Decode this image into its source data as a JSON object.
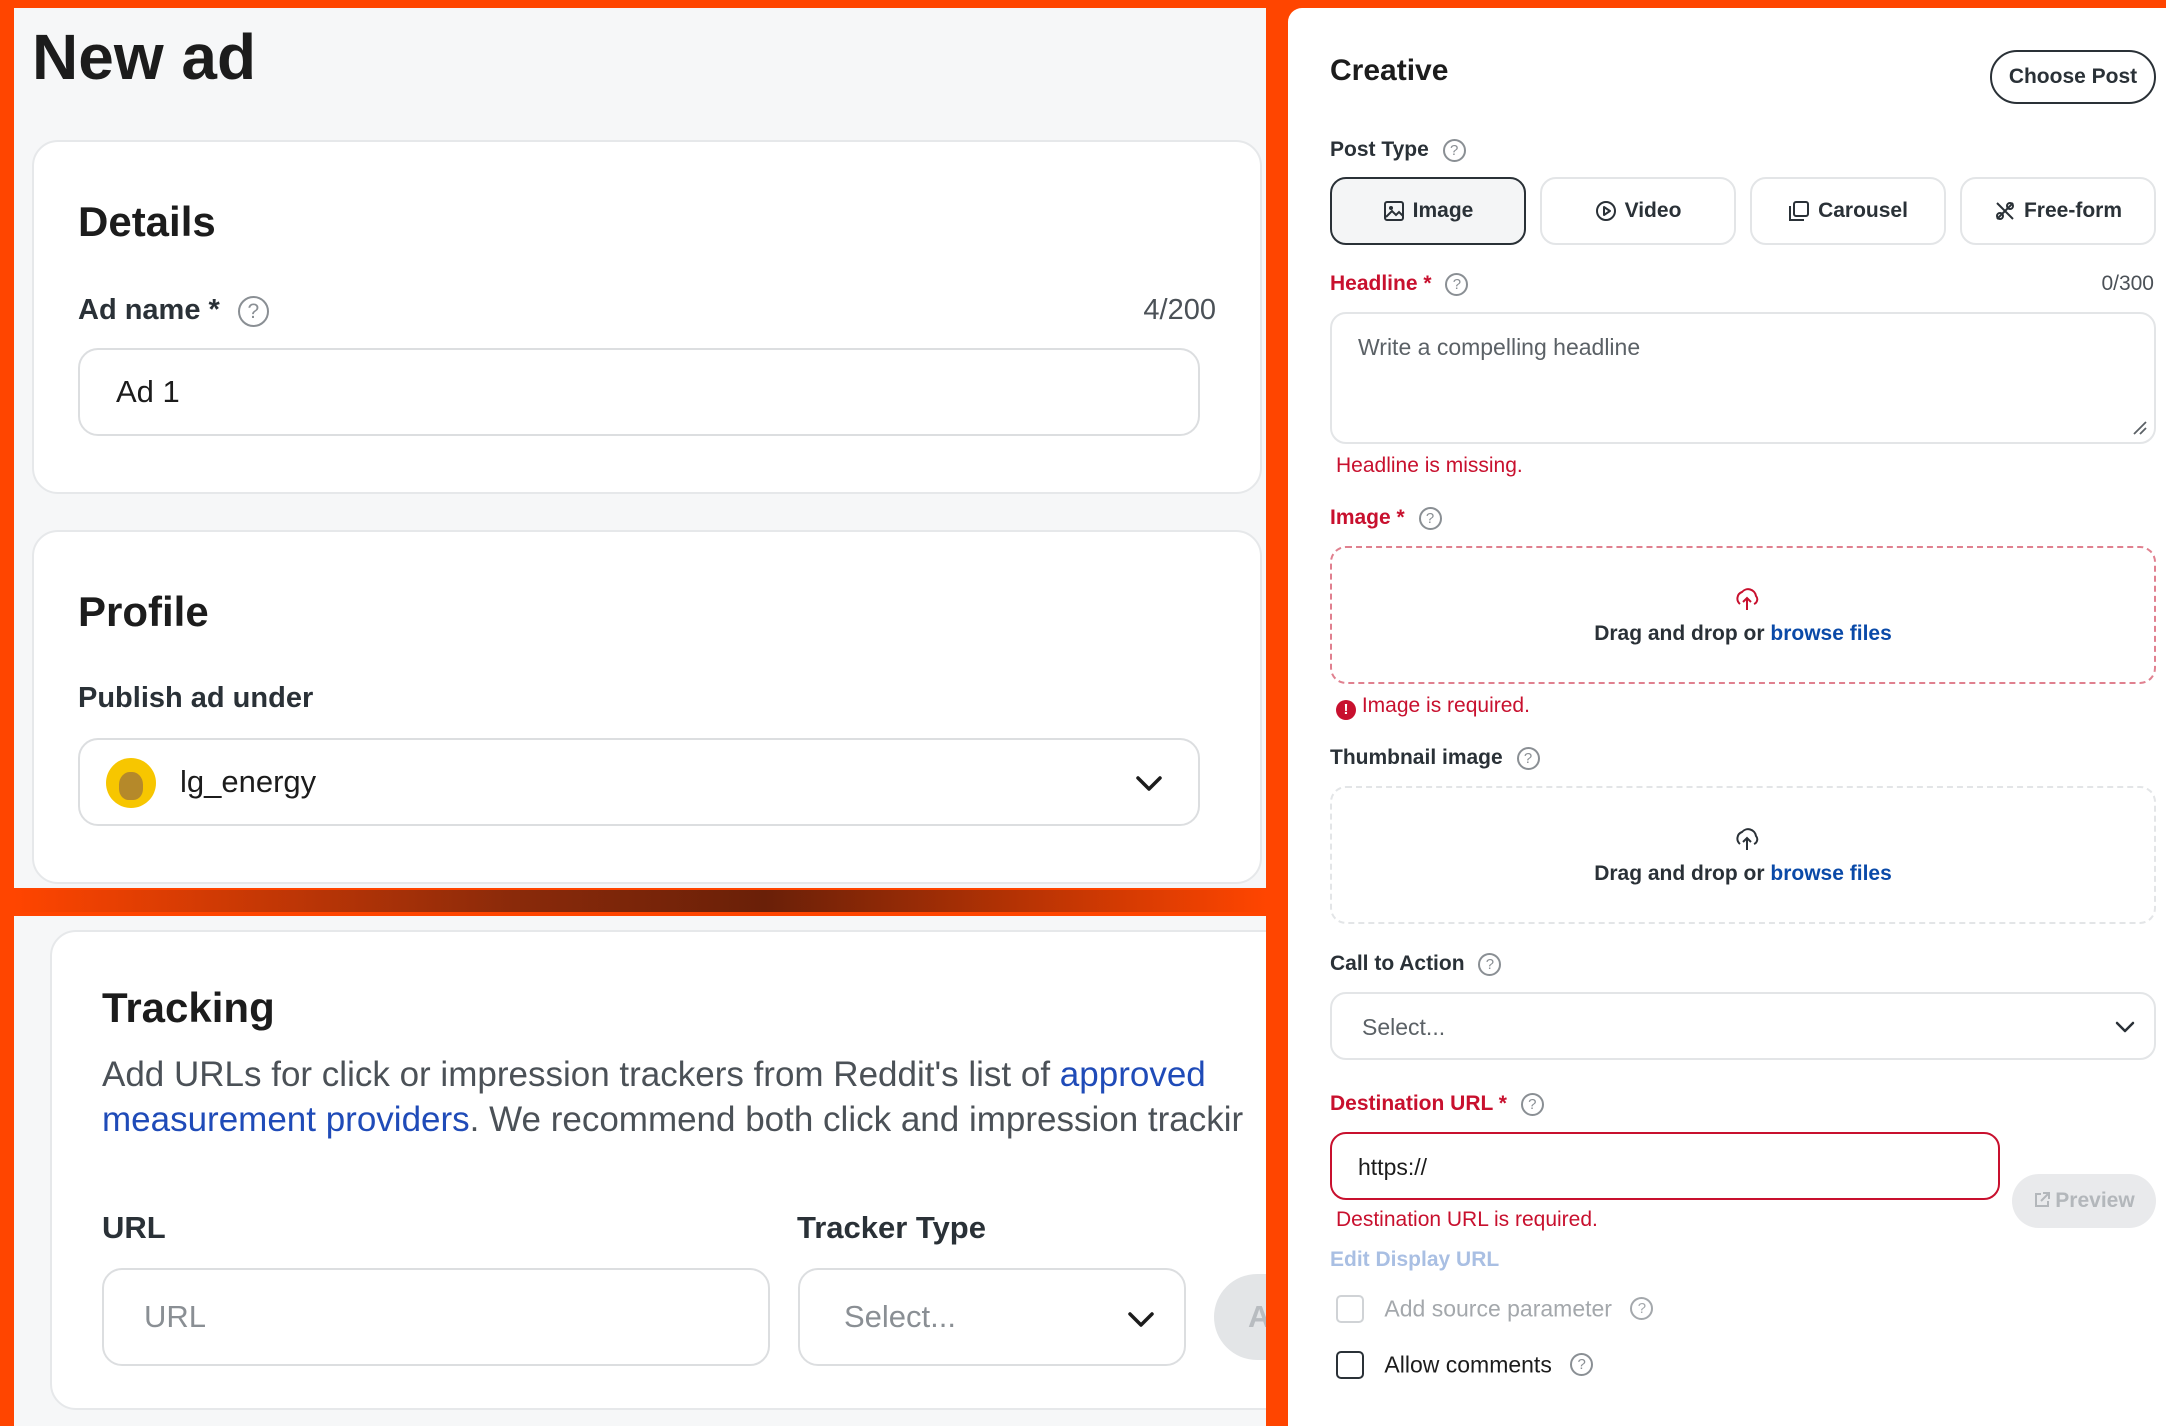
{
  "left_top": {
    "page_title": "New ad",
    "details": {
      "title": "Details",
      "ad_name_label": "Ad name *",
      "ad_name_counter": "4/200",
      "ad_name_value": "Ad 1"
    },
    "profile": {
      "title": "Profile",
      "publish_label": "Publish ad under",
      "selected_profile": "lg_energy"
    }
  },
  "tracking": {
    "title": "Tracking",
    "description_pre": "Add URLs for click or impression trackers from Reddit's list of ",
    "link_text_1": "approved",
    "link_text_2": "measurement providers",
    "description_post": ". We recommend both click and impression trackir",
    "url_label": "URL",
    "url_placeholder": "URL",
    "tracker_type_label": "Tracker Type",
    "tracker_type_value": "Select...",
    "add_button_partial": "A"
  },
  "creative": {
    "title": "Creative",
    "choose_post_label": "Choose Post",
    "post_type_label": "Post Type",
    "post_types": [
      {
        "label": "Image",
        "icon": "image-icon",
        "active": true
      },
      {
        "label": "Video",
        "icon": "video-icon",
        "active": false
      },
      {
        "label": "Carousel",
        "icon": "carousel-icon",
        "active": false
      },
      {
        "label": "Free-form",
        "icon": "free-form-icon",
        "active": false
      }
    ],
    "headline_label": "Headline *",
    "headline_counter": "0/300",
    "headline_placeholder": "Write a compelling headline",
    "headline_error": "Headline is missing.",
    "image_label": "Image *",
    "image_drop_text": "Drag and drop or ",
    "image_browse_link": "browse files",
    "image_error": "Image is required.",
    "thumbnail_label": "Thumbnail image",
    "thumbnail_drop_text": "Drag and drop or ",
    "thumbnail_browse_link": "browse files",
    "cta_label": "Call to Action",
    "cta_value": "Select...",
    "destination_label": "Destination URL *",
    "destination_value": "https://",
    "destination_error": "Destination URL is required.",
    "preview_label": "Preview",
    "edit_display_url": "Edit Display URL",
    "add_source_param": "Add source parameter",
    "allow_comments": "Allow comments"
  },
  "colors": {
    "frame": "#ff4500",
    "error": "#c8102e",
    "link": "#0a4aa8"
  }
}
